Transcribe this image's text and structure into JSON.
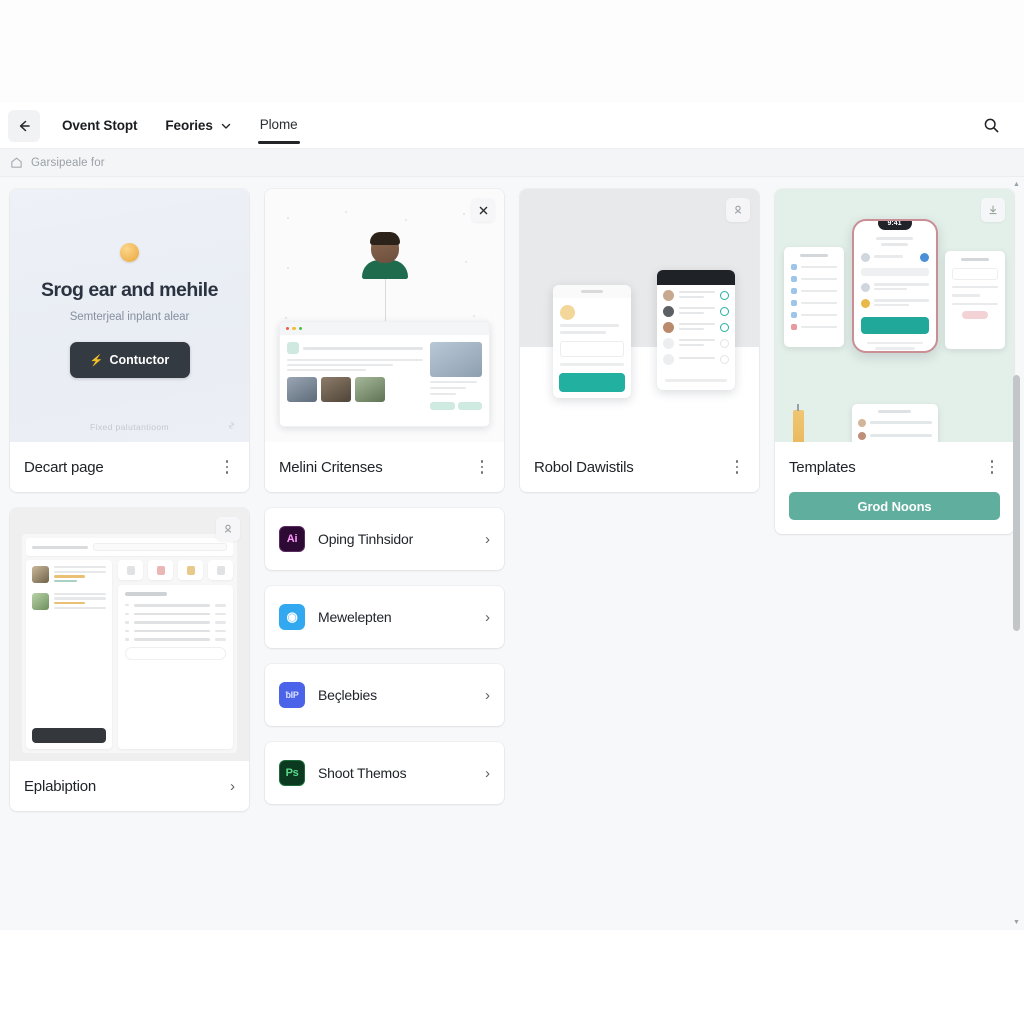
{
  "appbar": {
    "back_icon": "arrow-left-icon",
    "title": "Ovent Stopt",
    "dropdown_label": "Feories",
    "dropdown_icon": "chevron-down-icon",
    "tab_label": "Plome",
    "search_icon": "search-icon"
  },
  "breadcrumb": {
    "home_icon": "home-icon",
    "text": "Garsipeale for"
  },
  "cards": {
    "hero": {
      "badge_icon": "coin-badge-icon",
      "heading": "Srog ear and mehile",
      "subheading": "Semterjeal inplant alear",
      "cta_glyph": "⚡",
      "cta_label": "Contuctor",
      "footnote": "Fixed palutantioom",
      "corner_icon": "link-icon",
      "title": "Decart page",
      "menu_icon": "kebab-menu-icon"
    },
    "profile": {
      "close_icon": "close-icon",
      "title": "Melini Critenses",
      "menu_icon": "kebab-menu-icon"
    },
    "mobile": {
      "corner_icon": "user-pin-icon",
      "title": "Robol Dawistils",
      "menu_icon": "kebab-menu-icon"
    },
    "templates": {
      "corner_icon": "download-icon",
      "phone_time": "9:41",
      "title": "Templates",
      "menu_icon": "kebab-menu-icon",
      "cta_label": "Grod Noons"
    },
    "dashboard": {
      "corner_icon": "user-pin-icon",
      "title": "Eplabiption",
      "chevron_icon": "chevron-right-icon"
    }
  },
  "app_list": [
    {
      "icon_label": "Ai",
      "icon_name": "illustrator-icon",
      "label": "Oping Tinhsidor",
      "bg": "#2d0a33",
      "fg": "#ff9aff",
      "chevron_icon": "chevron-right-icon"
    },
    {
      "icon_label": "◉",
      "icon_name": "photo-app-icon",
      "label": "Mewelepten",
      "bg": "#31a8f0",
      "fg": "#ffffff",
      "chevron_icon": "chevron-right-icon"
    },
    {
      "icon_label": "ƀIP",
      "icon_name": "indesign-icon",
      "label": "Beçlebies",
      "bg": "#4a63e8",
      "fg": "#d9e0ff",
      "chevron_icon": "chevron-right-icon"
    },
    {
      "icon_label": "Ps",
      "icon_name": "photoshop-icon",
      "label": "Shoot Themos",
      "bg": "#0c3a20",
      "fg": "#5bd98a",
      "chevron_icon": "chevron-right-icon"
    }
  ],
  "scrollbar": {
    "up_icon": "caret-up-icon",
    "down_icon": "caret-down-icon"
  },
  "colors": {
    "accent_teal": "#5fae9e",
    "dark_cta": "#343a41",
    "page_bg": "#f7f8f9"
  }
}
